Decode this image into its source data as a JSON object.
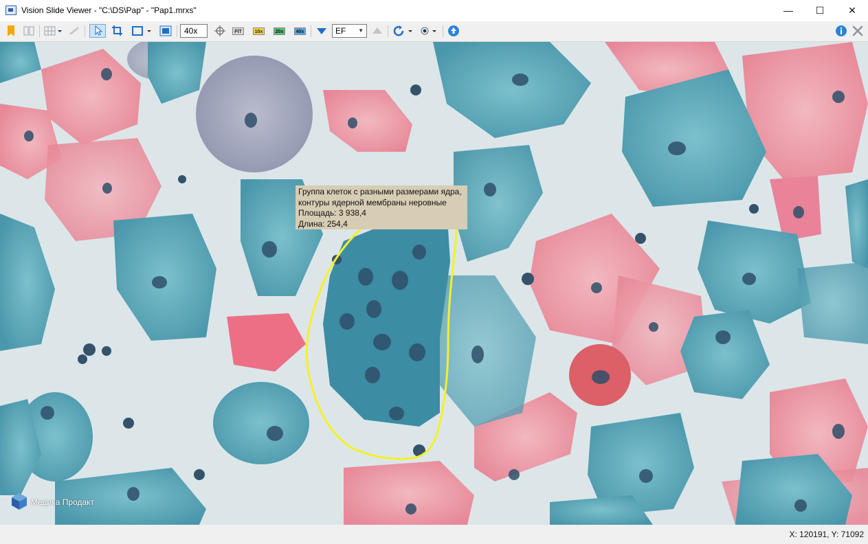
{
  "window": {
    "title": "Vision Slide Viewer - \"C:\\DS\\Pap\" - \"Pap1.mrxs\"",
    "controls": {
      "minimize": "—",
      "maximize": "☐",
      "close": "✕"
    }
  },
  "toolbar": {
    "zoom_value": "40x",
    "zoom_presets": [
      "FIT",
      "10x",
      "20x",
      "40x"
    ],
    "filter_value": "EF",
    "icons": [
      "bookmark-icon",
      "split-view-icon",
      "grid-icon",
      "link-icon",
      "pointer-icon",
      "crop-icon",
      "rectangle-icon",
      "screenshot-icon",
      "crosshair-icon",
      "arrow-down-icon",
      "arrow-up-icon",
      "rotate-icon",
      "circle-dot-icon",
      "upload-icon",
      "info-icon",
      "settings-icon"
    ]
  },
  "annotation": {
    "lines": [
      "Группа клеток с разными размерами ядра,",
      "контуры ядерной мембраны неровные",
      "Площадь: 3 938,4",
      "Длина: 254,4"
    ],
    "outline_color": "#f5f02a"
  },
  "branding": {
    "text": "Медика Продакт"
  },
  "status": {
    "coordinates": "X: 120191, Y: 71092"
  },
  "colors": {
    "toolbar_blue": "#1e6ec8",
    "tooltip_bg": "#d7ccb4",
    "selected_tool_bg": "#cce4f7"
  }
}
